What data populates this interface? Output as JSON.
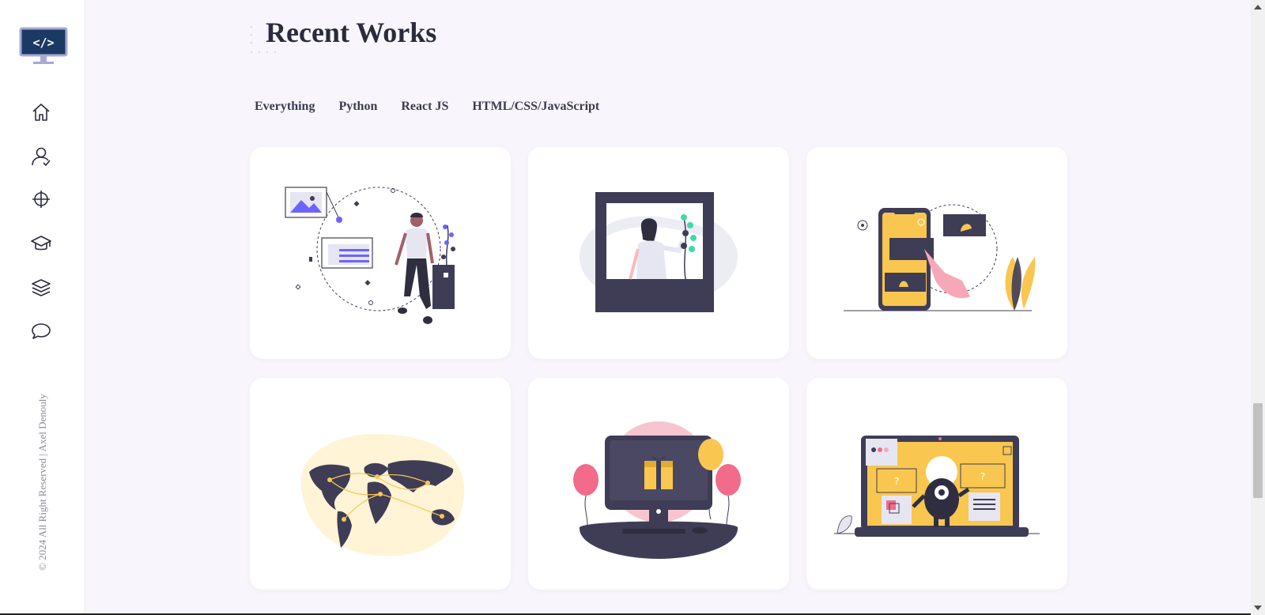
{
  "sidebar": {
    "logo_icon": "code-monitor-icon",
    "items": [
      {
        "name": "home",
        "icon": "home-icon"
      },
      {
        "name": "about",
        "icon": "user-icon"
      },
      {
        "name": "services",
        "icon": "crosshair-icon"
      },
      {
        "name": "education",
        "icon": "graduation-cap-icon"
      },
      {
        "name": "portfolio",
        "icon": "layers-icon"
      },
      {
        "name": "contact",
        "icon": "chat-bubble-icon"
      }
    ],
    "copyright": "© 2024 All Right Reserved | Axel Denouly"
  },
  "works": {
    "title": "Recent Works",
    "filters": [
      "Everything",
      "Python",
      "React JS",
      "HTML/CSS/JavaScript"
    ],
    "cards": [
      {
        "illustration": "man-with-image-and-text-cards"
      },
      {
        "illustration": "woman-in-photo-frame"
      },
      {
        "illustration": "phone-touch-gallery"
      },
      {
        "illustration": "world-map-connections"
      },
      {
        "illustration": "monitor-gift-balloons"
      },
      {
        "illustration": "laptop-robot-windows"
      }
    ]
  },
  "colors": {
    "accent_purple": "#6c63ff",
    "dark": "#3f3d56",
    "yellow": "#f9c74f",
    "pink": "#f7a8b8",
    "teal": "#3fd9a8",
    "background": "#f8f6fc"
  }
}
